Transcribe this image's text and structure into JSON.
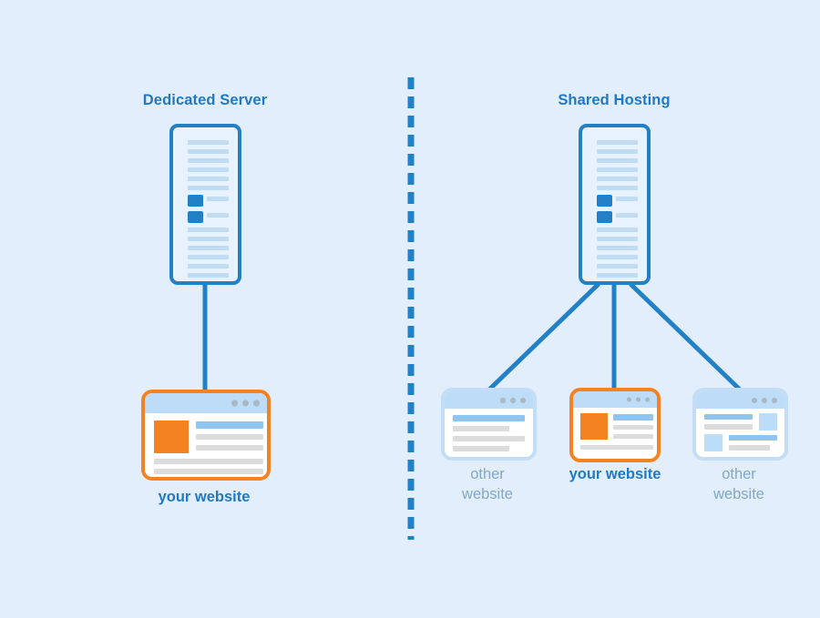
{
  "background_color": "#e2eefb",
  "colors": {
    "accent_blue": "#2280c6",
    "title_blue": "#2079c4",
    "accent_orange": "#f58220",
    "muted_blue": "#7fa8c9",
    "card_border_plain": "#c2ddf5",
    "line_gray": "#dcdcdc",
    "line_blue": "#8fc4ee",
    "titlebar_blue": "#bcdcf7"
  },
  "panels": {
    "left": {
      "title": "Dedicated Server",
      "server_name": "dedicated-server-tower",
      "website": {
        "caption": "your website",
        "highlighted": true
      }
    },
    "right": {
      "title": "Shared Hosting",
      "server_name": "shared-server-tower",
      "websites": [
        {
          "caption": "other\nwebsite",
          "highlighted": false
        },
        {
          "caption": "your website",
          "highlighted": true
        },
        {
          "caption": "other\nwebsite",
          "highlighted": false
        }
      ]
    }
  },
  "divider": {
    "name": "vertical-dashed-divider",
    "style": "dashed",
    "color": "#2280c6"
  },
  "icons": {
    "server": "server-tower-icon",
    "browser": "browser-window-icon",
    "dots": "window-control-dots-icon",
    "connector": "connector-line-icon"
  }
}
